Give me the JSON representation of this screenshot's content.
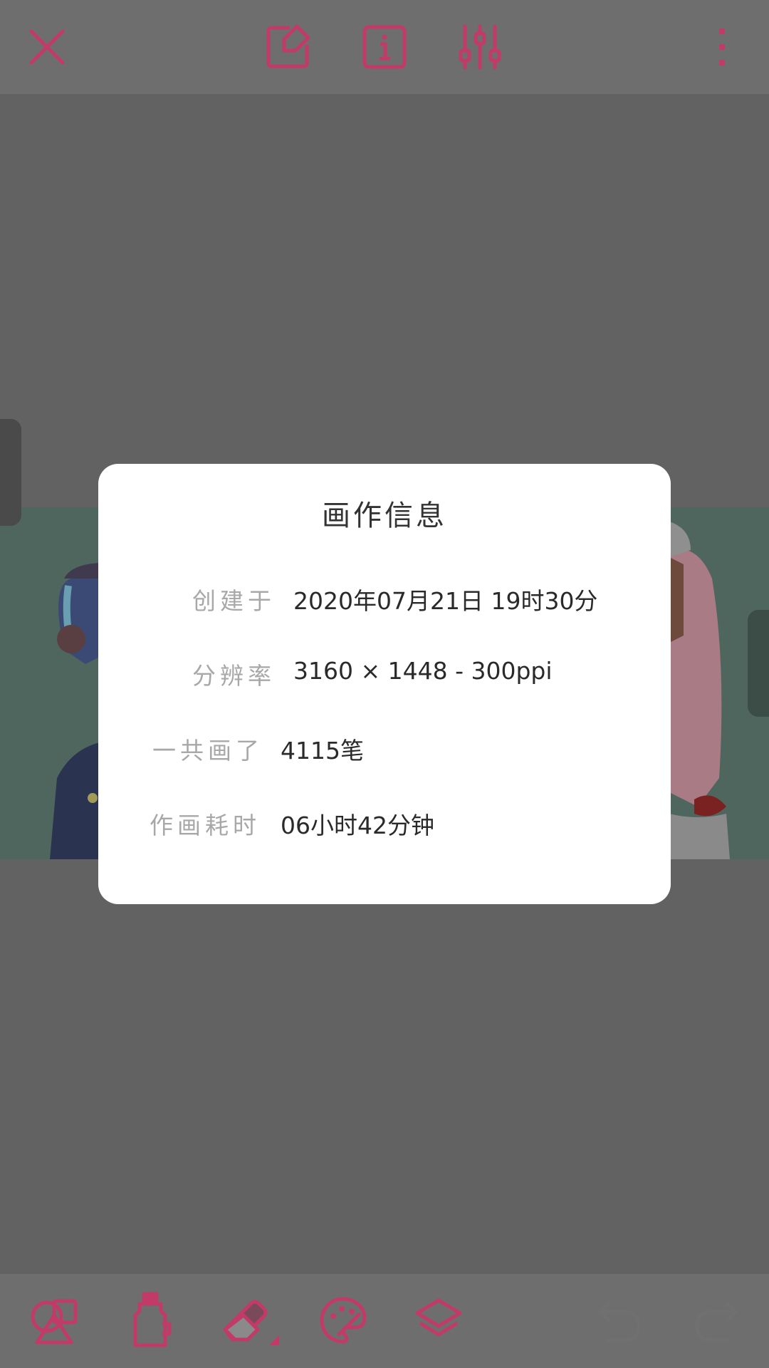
{
  "toolbar_top": {
    "icons": [
      "close-icon",
      "edit-canvas-icon",
      "info-icon",
      "adjust-sliders-icon",
      "more-vertical-icon"
    ]
  },
  "toolbar_bottom": {
    "icons": [
      "shapes-icon",
      "ink-bottle-icon",
      "eraser-icon",
      "palette-icon",
      "layers-icon",
      "undo-icon",
      "redo-icon"
    ]
  },
  "colors": {
    "accent": "#c23a68",
    "overlay_bg": "#626262",
    "bar_bg": "#6e6e6e",
    "dialog_bg": "#ffffff",
    "label": "#a8a8a8",
    "value": "#2a2a2a"
  },
  "dialog": {
    "title": "画作信息",
    "rows": [
      {
        "label": "创建于",
        "value": "2020年07月21日 19时30分"
      },
      {
        "label": "分辨率",
        "value": "3160 × 1448 - 300ppi"
      },
      {
        "label": "一共画了",
        "value": "4115笔"
      },
      {
        "label": "作画耗时",
        "value": "06小时42分钟"
      }
    ]
  }
}
